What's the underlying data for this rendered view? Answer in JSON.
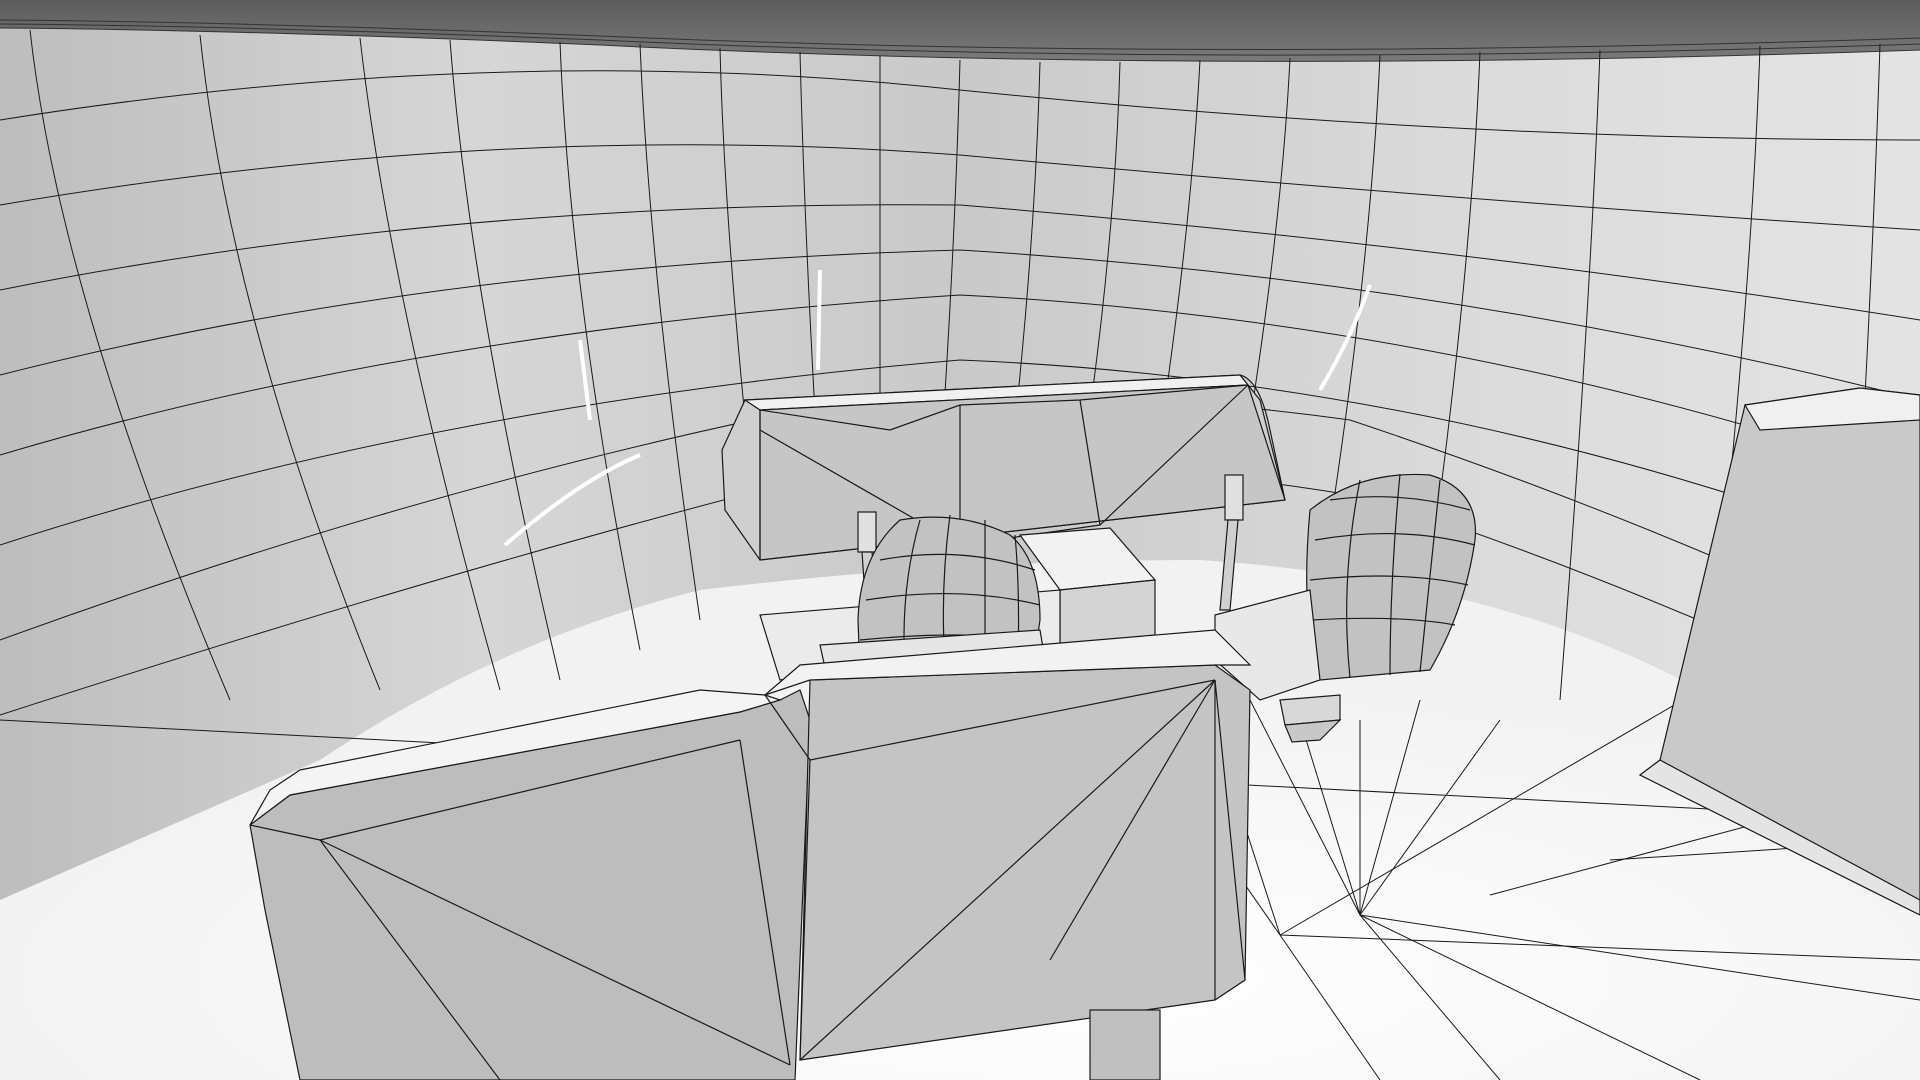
{
  "scene": {
    "kind": "wireframe-3d-viewport",
    "subject": "cockpit-interior",
    "colors": {
      "ceiling": "#6a6a6a",
      "ceiling_edge": "#4a4a4a",
      "wall_dark": "#b8b8b8",
      "wall_mid": "#d2d2d2",
      "wall_light": "#e6e6e6",
      "floor": "#ffffff",
      "console_top": "#f4f4f4",
      "console_front": "#cfcfcf",
      "seat_face": "#c4c4c4",
      "seat_top": "#f2f2f2",
      "wire": "#1a1a1a"
    }
  }
}
